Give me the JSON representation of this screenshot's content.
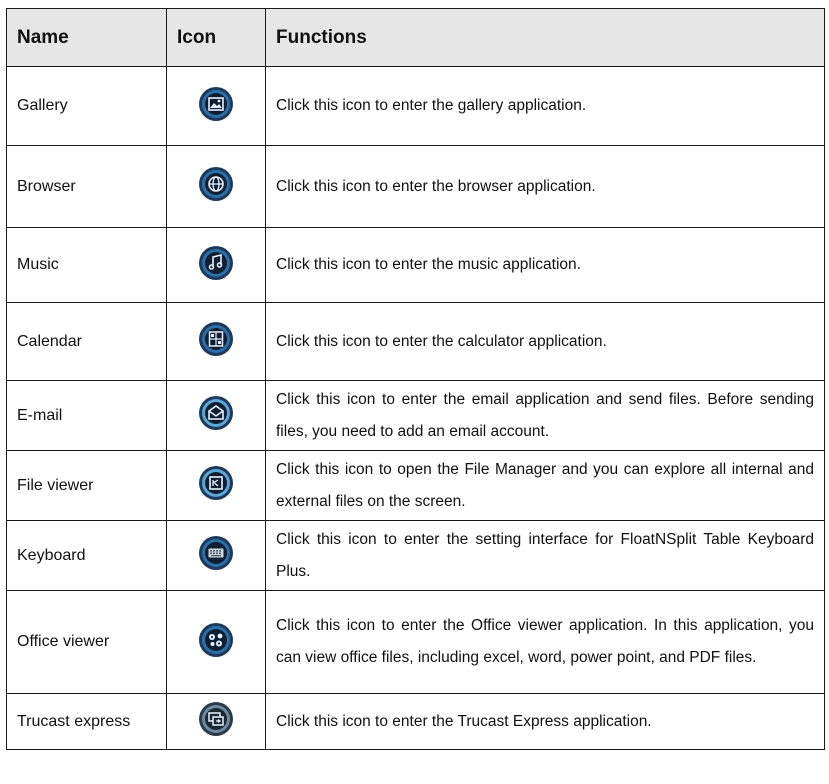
{
  "header": {
    "name": "Name",
    "icon": "Icon",
    "functions": "Functions"
  },
  "rows": [
    {
      "name": "Gallery",
      "icon": "gallery-icon",
      "func": "Click this icon to enter the gallery application."
    },
    {
      "name": "Browser",
      "icon": "browser-icon",
      "func": "Click this icon to enter the browser application."
    },
    {
      "name": "Music",
      "icon": "music-icon",
      "func": "Click this icon to enter the music application."
    },
    {
      "name": "Calendar",
      "icon": "calculator-icon",
      "func": "Click this icon to enter the calculator application."
    },
    {
      "name": "E-mail",
      "icon": "email-icon",
      "func": "Click this icon to enter the email application and send files. Before sending files, you need to add an email account."
    },
    {
      "name": "File viewer",
      "icon": "file-viewer-icon",
      "func": "Click this icon to open the File Manager and you can explore all internal and external files on the screen."
    },
    {
      "name": "Keyboard",
      "icon": "keyboard-icon",
      "func": "Click this icon to enter the setting interface for FloatNSplit Table Keyboard Plus."
    },
    {
      "name": "Office viewer",
      "icon": "office-viewer-icon",
      "func": "Click this icon to enter the Office viewer application. In this application, you can view office files, including excel, word, power point, and PDF files."
    },
    {
      "name": "Trucast express",
      "icon": "trucast-icon",
      "func": "Click this icon to enter the Trucast Express application."
    }
  ]
}
